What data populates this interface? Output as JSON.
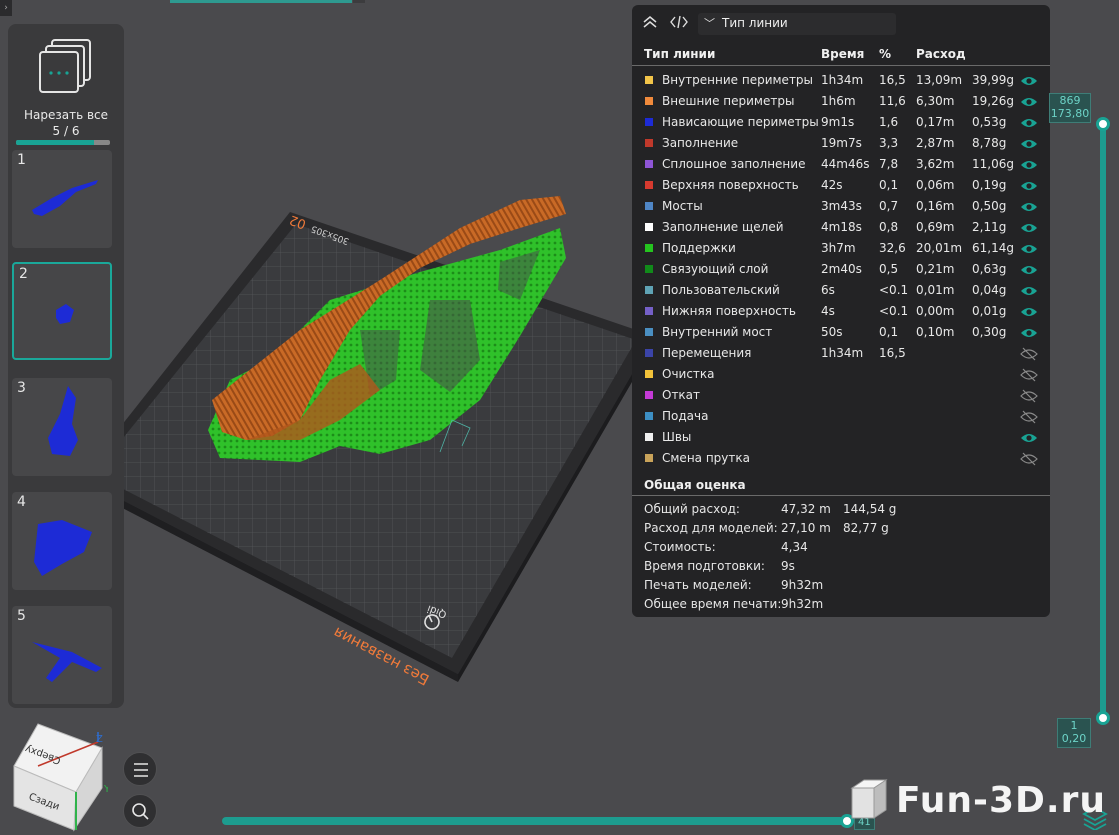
{
  "sidebar": {
    "slice_all_label": "Нарезать все",
    "slice_all_count": "5 / 6",
    "slice_all_progress": 0.83,
    "plates": [
      {
        "num": "1"
      },
      {
        "num": "2",
        "active": true
      },
      {
        "num": "3"
      },
      {
        "num": "4"
      },
      {
        "num": "5"
      }
    ]
  },
  "plate_bed": {
    "name": "Без названия",
    "plate_number": "02",
    "size_label": "305x305",
    "brand": "Qidi"
  },
  "panel": {
    "header": {
      "collapse_icon": "double-chevron-up-icon",
      "code_icon": "code-brackets-icon",
      "dropdown_chevron": "﹀",
      "line_type_value": "Тип линии"
    },
    "columns": {
      "line_type": "Тип линии",
      "time": "Время",
      "percent": "%",
      "usage": "Расход"
    },
    "rows": [
      {
        "color": "#f2c449",
        "name": "Внутренние периметры",
        "time": "1h34m",
        "pct": "16,5",
        "len": "13,09m",
        "weight": "39,99g",
        "visible": true
      },
      {
        "color": "#f08a3c",
        "name": "Внешние периметры",
        "time": "1h6m",
        "pct": "11,6",
        "len": "6,30m",
        "weight": "19,26g",
        "visible": true
      },
      {
        "color": "#1d2bd6",
        "name": "Нависающие периметры",
        "time": "9m1s",
        "pct": "1,6",
        "len": "0,17m",
        "weight": "0,53g",
        "visible": true
      },
      {
        "color": "#c0392b",
        "name": "Заполнение",
        "time": "19m7s",
        "pct": "3,3",
        "len": "2,87m",
        "weight": "8,78g",
        "visible": true
      },
      {
        "color": "#8e55d6",
        "name": "Сплошное заполнение",
        "time": "44m46s",
        "pct": "7,8",
        "len": "3,62m",
        "weight": "11,06g",
        "visible": true
      },
      {
        "color": "#d63a2f",
        "name": "Верхняя поверхность",
        "time": "42s",
        "pct": "0,1",
        "len": "0,06m",
        "weight": "0,19g",
        "visible": true
      },
      {
        "color": "#4f86c6",
        "name": "Мосты",
        "time": "3m43s",
        "pct": "0,7",
        "len": "0,16m",
        "weight": "0,50g",
        "visible": true
      },
      {
        "color": "#ffffff",
        "name": "Заполнение щелей",
        "time": "4m18s",
        "pct": "0,8",
        "len": "0,69m",
        "weight": "2,11g",
        "visible": true
      },
      {
        "color": "#25c41f",
        "name": "Поддержки",
        "time": "3h7m",
        "pct": "32,6",
        "len": "20,01m",
        "weight": "61,14g",
        "visible": true
      },
      {
        "color": "#118a1a",
        "name": "Связующий слой",
        "time": "2m40s",
        "pct": "0,5",
        "len": "0,21m",
        "weight": "0,63g",
        "visible": true
      },
      {
        "color": "#5fa3b5",
        "name": "Пользовательский",
        "time": "6s",
        "pct": "<0.1",
        "len": "0,01m",
        "weight": "0,04g",
        "visible": true
      },
      {
        "color": "#7560c8",
        "name": "Нижняя поверхность",
        "time": "4s",
        "pct": "<0.1",
        "len": "0,00m",
        "weight": "0,01g",
        "visible": true
      },
      {
        "color": "#4a8fc2",
        "name": "Внутренний мост",
        "time": "50s",
        "pct": "0,1",
        "len": "0,10m",
        "weight": "0,30g",
        "visible": true
      },
      {
        "color": "#3b44a8",
        "name": "Перемещения",
        "time": "1h34m",
        "pct": "16,5",
        "len": "",
        "weight": "",
        "visible": false
      },
      {
        "color": "#f2c23a",
        "name": "Очистка",
        "time": "",
        "pct": "",
        "len": "",
        "weight": "",
        "visible": false
      },
      {
        "color": "#c43ad6",
        "name": "Откат",
        "time": "",
        "pct": "",
        "len": "",
        "weight": "",
        "visible": false
      },
      {
        "color": "#3d8fc4",
        "name": "Подача",
        "time": "",
        "pct": "",
        "len": "",
        "weight": "",
        "visible": false
      },
      {
        "color": "#f0f0f0",
        "name": "Швы",
        "time": "",
        "pct": "",
        "len": "",
        "weight": "",
        "visible": true
      },
      {
        "color": "#c9a35a",
        "name": "Смена прутка",
        "time": "",
        "pct": "",
        "len": "",
        "weight": "",
        "visible": false
      }
    ],
    "summary_title": "Общая оценка",
    "summary": [
      {
        "label": "Общий расход:",
        "v1": "47,32 m",
        "v2": "144,54 g"
      },
      {
        "label": "Расход для моделей:",
        "v1": "27,10 m",
        "v2": "82,77 g"
      },
      {
        "label": "Стоимость:",
        "v1": "4,34",
        "v2": ""
      },
      {
        "label": "Время подготовки:",
        "v1": "9s",
        "v2": ""
      },
      {
        "label": "Печать моделей:",
        "v1": "9h32m",
        "v2": ""
      },
      {
        "label": "Общее время печати:",
        "v1": "9h32m",
        "v2": ""
      }
    ]
  },
  "layer_slider": {
    "top_layer": "869",
    "top_height": "173,80",
    "bottom_layer": "1",
    "bottom_height": "0,20"
  },
  "move_slider": {
    "label": "41"
  },
  "view_cube": {
    "top_label": "Сверху",
    "front_label": "Сзади",
    "axis_z": "Z",
    "axis_y": "Y"
  },
  "watermark": "Fun-3D.ru",
  "colors": {
    "accent": "#19a394",
    "panel_bg": "#232325",
    "background": "#4a4a4d"
  }
}
